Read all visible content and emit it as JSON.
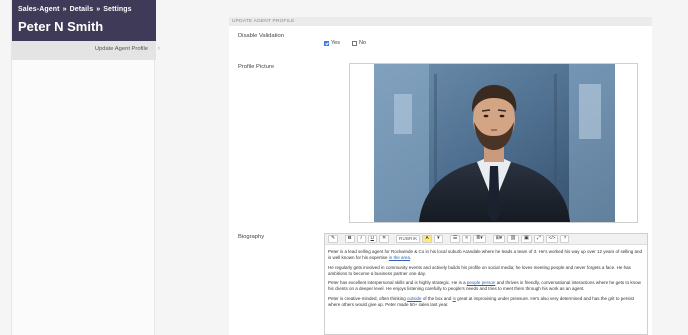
{
  "breadcrumb": [
    "Sales-Agent",
    "Details",
    "Settings"
  ],
  "agent_name": "Peter N Smith",
  "side_nav": {
    "active_item": "Update Agent Profile"
  },
  "section_title": "UPDATE AGENT PROFILE",
  "fields": {
    "disable_validation_label": "Disable Validation",
    "yes_label": "Yes",
    "no_label": "No",
    "disable_validation_value": "Yes",
    "profile_picture_label": "Profile Picture",
    "biography_label": "Biography"
  },
  "toolbar": {
    "font_label": "RUBRIK",
    "buttons": [
      "B",
      "I",
      "U"
    ]
  },
  "biography": {
    "p1_a": "Peter is a lead selling agent for Rockwinde & Co in his local suburb Arandale where he leads a team of 3. He's worked his way up over 12 years of selling and is well known for his expertise ",
    "p1_link": "in the area",
    "p1_b": ".",
    "p2": "He regularly gets involved in community events and actively builds his profile on social media; he loves meeting people and never forgets a face. He has ambitions to become a business partner one day.",
    "p3_a": "Peter has excellent interpersonal skills and is highly strategic. He is a ",
    "p3_link": "people person",
    "p3_b": " and thrives in friendly, conversational interactions where he gets to know his clients on a deeper level. He enjoys listening carefully to people's needs and tries to meet them through his work as an agent.",
    "p4_a": "Peter is creative-minded, often thinking ",
    "p4_link1": "outside",
    "p4_mid": " of the box and ",
    "p4_link2": "is",
    "p4_b": " great at improvising under pressure. He's also very determined and has the grit to persist where others would give up. Peter made 50+ sales last year."
  },
  "colors": {
    "header_bg": "#3f3a57",
    "checkbox_on": "#3d7de0",
    "link": "#2d5fb3"
  }
}
